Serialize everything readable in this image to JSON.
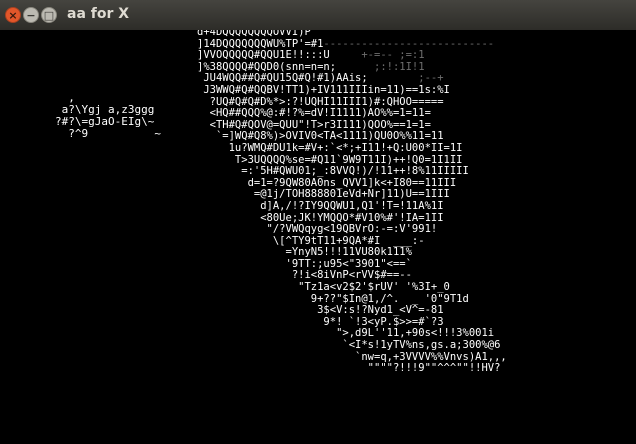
{
  "window": {
    "title": "aa for X",
    "close_glyph": "×",
    "minimize_glyph": "−",
    "maximize_glyph": "□"
  },
  "art": {
    "small_text": "  ,\n a?\\Ygj a,z3ggg\n?#?\\=gJaO-EIg\\~\n  ?^9          ~",
    "bright_text": "d+4DQQQQQQQQOVVI)P`\n]14DQQQQQQQWU%TP'=#1\n]VVOQQQQQ#QQU1E!!:::U\n]%38QQQQ#QQD0(snn=n=n;\n JU4WQQ##Q#QU15Q#Q!#1)AAis;\n J3WWQ#Q#QQBV!TT1)+IV111IIIin=11)==1s:%I\n  ?UQ#Q#Q#D%*>:?!UQHI11III1)#:QHOO=====\n  <HQ##QQQ%@:#!?%=dV!I1111)AO%%=1=11=\n  <TH#Q#QOV@=QUU\"!T>r3I111)QOO%==1=1=\n   `=]WQ#Q8%)>OVIV0<TA<1111)QU0O%%11=11\n     1u?WMQ#DU1k=#V+:`<*;+I11!+Q:U00*II=1I\n      T>3UQQQQ%se=#Q11`9W9T11I)++!Q0=1I1II\n       =:'5H#QWU01;_:8VVQ!)/!11++!8%11IIIII\n        d=1=?9QW80A0ns_QVV1]k<+I80==11III\n         =@1j/TOH888801eVd+Nr]11)U==1III\n          d]A,/!?IY9QQWU1,Q1'!T=!11A%1I\n          <80Ue;JK!YMQQO*#V10%#'!IA=1II\n           \"/?VWQqyg<19QBVrO:-=:V'991!\n            \\[^TY9tT11+9QA*#I  ___:-\n              =YnyN5!!!11VU80k111%\n              '9TT:;u95<\"3901\"<==`\n               ?!i<8iVnP<rVV$#==--\n                \"Tz1a<v2$2'$rUV' '%3I+_0\n                  9+??\"$In@1,/^.  _ '0\"9T1d\n                   3$<V:s!?Nyd1_<V^=-81\n                    9*! `!3<yP.$>>=#`?3\n                      \">,d9L''11,+90s<!!!3%001i\n                       `<I*s!1yTV%ns,gs.a;300%@6\n                         `nw=q,+3VVVV%%Vnvs)A1,,,\n                           \"\"\"\"?!!!9\"\"^^^\"\"!!HV?",
    "dim_text": "\n                    ---------------------------\n                          +-=-- ;=:1\n                            ;:!:1I!1\n                                   ;--+\n\n\n\n\n\n\n\n\n\n\n\n\n\n\n\n\n\n\n\n\n\n\n\n\n\n\n\n\n\n"
  }
}
